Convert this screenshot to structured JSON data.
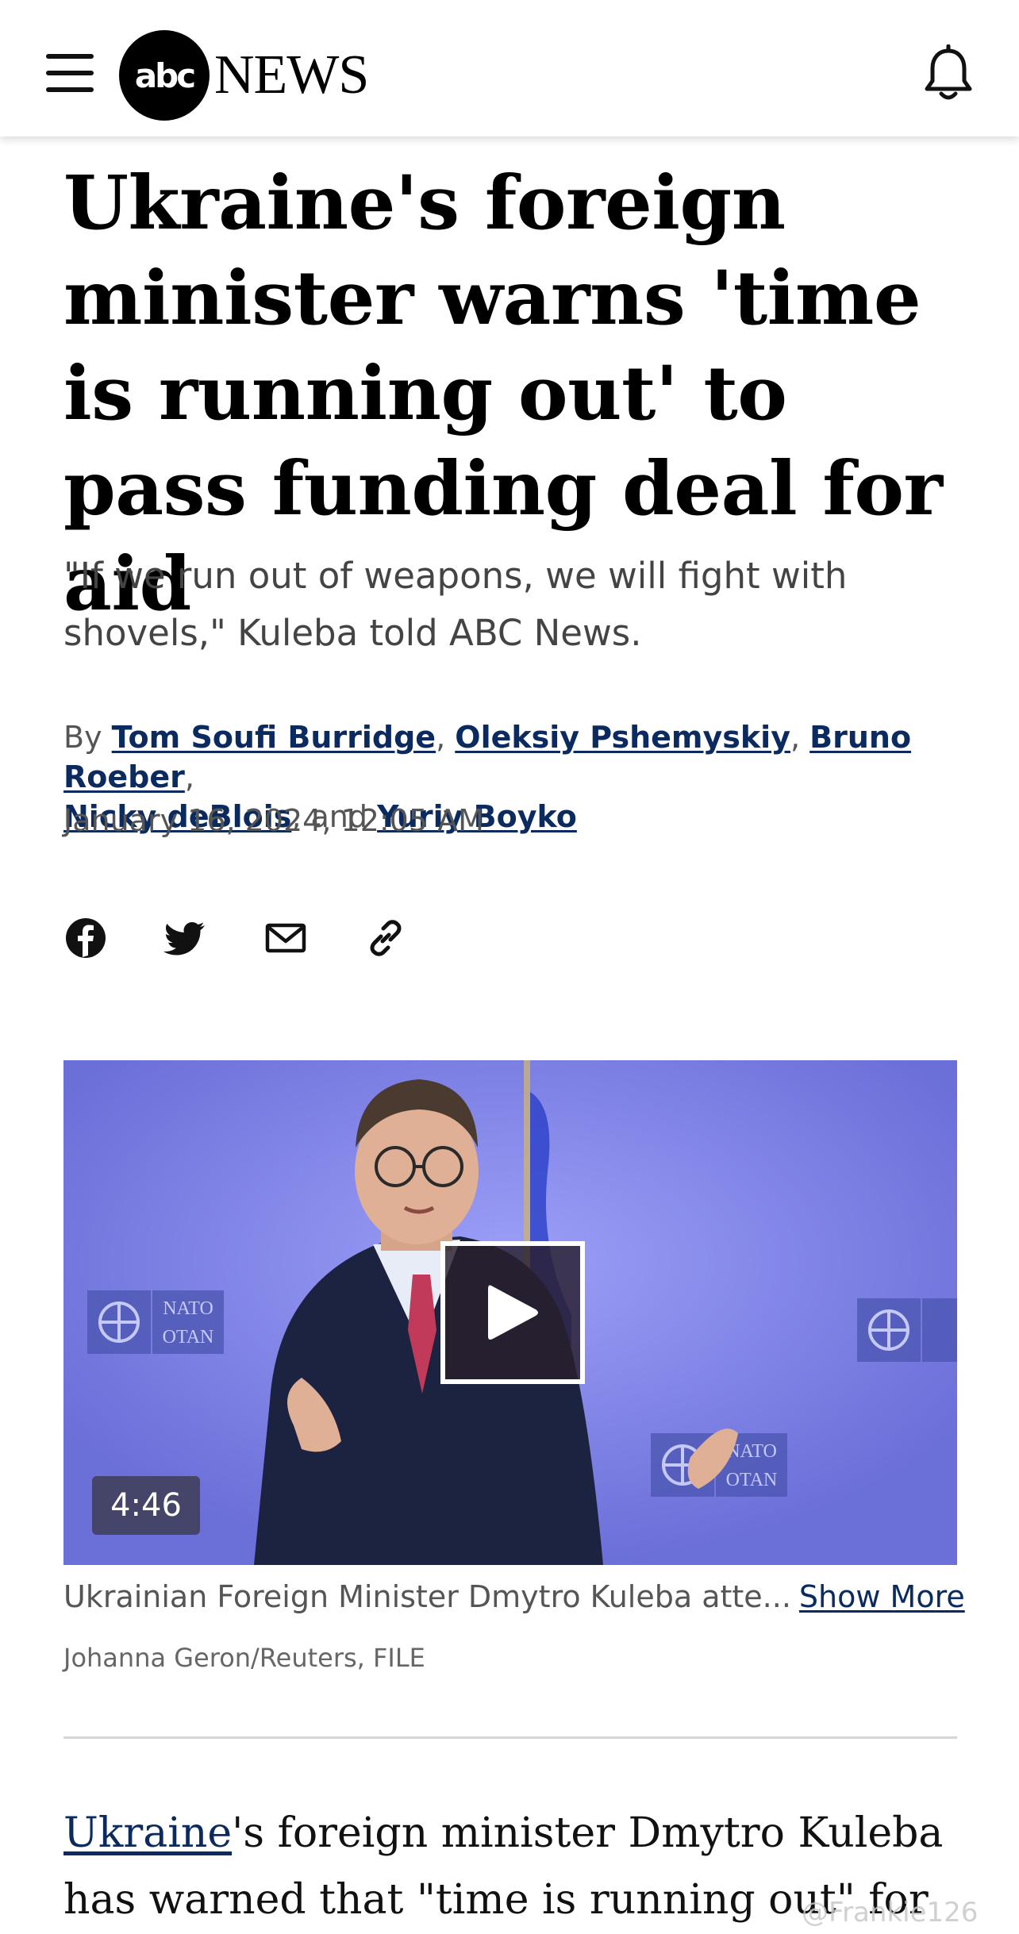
{
  "header": {
    "logo_mark": "abc",
    "logo_word": "NEWS",
    "menu_icon": "hamburger-menu-icon",
    "notification_icon": "bell-icon"
  },
  "article": {
    "headline": "Ukraine's foreign minister warns 'time is running out' to pass funding deal for aid",
    "dek": "\"If we run out of weapons, we will fight with shovels,\" Kuleba told ABC News.",
    "byline": {
      "prefix": "By",
      "authors": [
        "Tom Soufi Burridge",
        "Oleksiy Pshemyskiy",
        "Bruno Roeber",
        "Nicky deBlois",
        "Yuriy Boyko"
      ],
      "sep": ",",
      "and": ", and"
    },
    "date": "January 16, 2024, 12:05 AM"
  },
  "share": {
    "icons": [
      "facebook-icon",
      "twitter-icon",
      "email-icon",
      "link-icon"
    ]
  },
  "media": {
    "duration": "4:46",
    "caption": "Ukrainian Foreign Minister Dmytro Kuleba atte...",
    "show_more": "Show More",
    "credit": "Johanna Geron/Reuters, FILE",
    "backdrop_text": [
      "NATO",
      "OTAN"
    ]
  },
  "body": {
    "link_text": "Ukraine",
    "line1_rest": "'s foreign minister Dmytro Kuleba",
    "line2": "has warned that \"time is running out\" for"
  },
  "watermark": "@Frankie126",
  "colors": {
    "link": "#0b2a60",
    "video_bg": "#7a7ee6"
  }
}
